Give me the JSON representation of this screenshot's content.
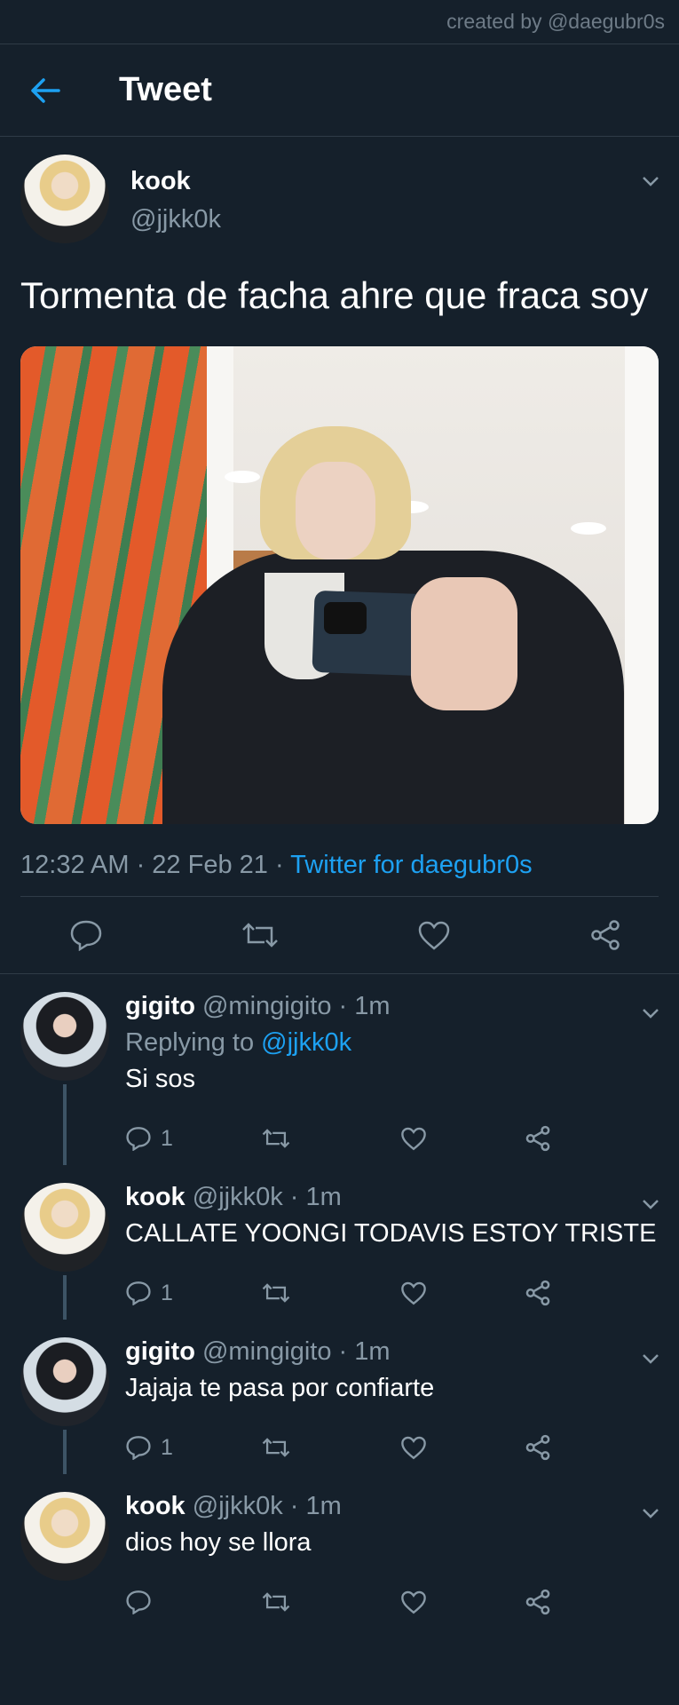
{
  "credit": "created by @daegubr0s",
  "header": {
    "title": "Tweet"
  },
  "tweet": {
    "name": "kook",
    "handle": "@jjkk0k",
    "text": "Tormenta de facha ahre que fraca soy",
    "time": "12:32 AM · 22 Feb 21 · ",
    "source": "Twitter for daegubr0s"
  },
  "replies": [
    {
      "name": "gigito",
      "meta": "@mingigito · 1m",
      "replying_prefix": "Replying to ",
      "replying_to": "@jjkk0k",
      "text": "Si sos",
      "reply_count": "1"
    },
    {
      "name": "kook",
      "meta": "@jjkk0k · 1m",
      "text": "CALLATE YOONGI TODAVIS ESTOY TRISTE",
      "reply_count": "1"
    },
    {
      "name": "gigito",
      "meta": "@mingigito · 1m",
      "text": "Jajaja te pasa por confiarte",
      "reply_count": "1"
    },
    {
      "name": "kook",
      "meta": "@jjkk0k · 1m",
      "text": "dios hoy se llora",
      "reply_count": ""
    }
  ],
  "colors": {
    "background": "#15202b",
    "accent": "#1da1f2",
    "muted": "#8899a6"
  },
  "icons": [
    "back-arrow-icon",
    "chevron-down-icon",
    "reply-icon",
    "retweet-icon",
    "like-icon",
    "share-icon"
  ]
}
